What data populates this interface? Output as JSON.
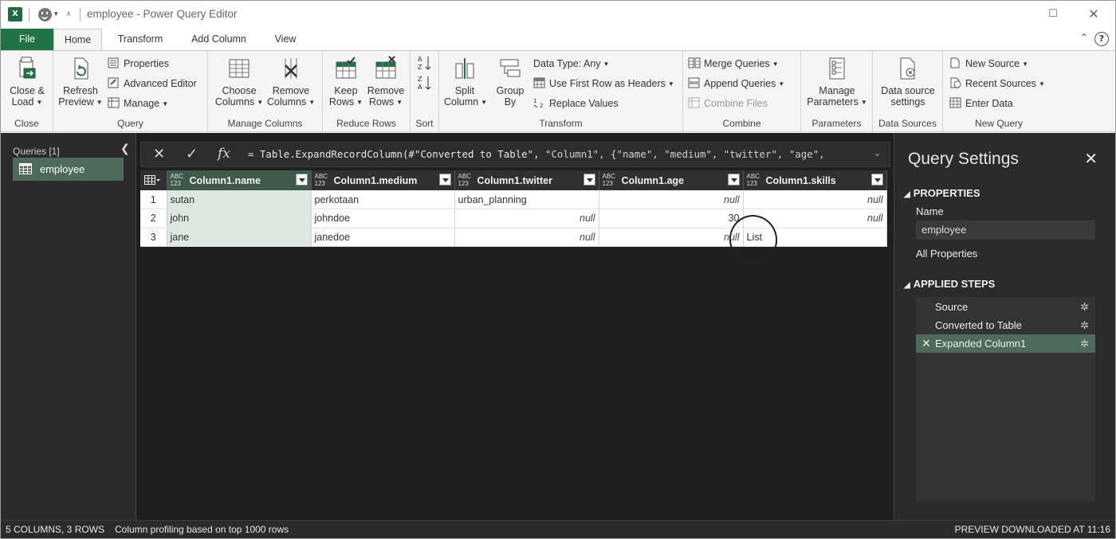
{
  "window": {
    "title": "employee - Power Query Editor",
    "app_icon": "excel-icon"
  },
  "tabs": [
    {
      "label": "File"
    },
    {
      "label": "Home"
    },
    {
      "label": "Transform"
    },
    {
      "label": "Add Column"
    },
    {
      "label": "View"
    }
  ],
  "ribbon": {
    "close": {
      "group_label": "Close",
      "close_load": "Close &",
      "close_load2": "Load"
    },
    "query": {
      "group_label": "Query",
      "refresh": "Refresh",
      "refresh2": "Preview",
      "properties": "Properties",
      "advanced_editor": "Advanced Editor",
      "manage": "Manage"
    },
    "manage_columns": {
      "group_label": "Manage Columns",
      "choose": "Choose",
      "choose2": "Columns",
      "remove": "Remove",
      "remove2": "Columns"
    },
    "reduce_rows": {
      "group_label": "Reduce Rows",
      "keep": "Keep",
      "keep2": "Rows",
      "remove": "Remove",
      "remove2": "Rows"
    },
    "sort": {
      "group_label": "Sort"
    },
    "transform": {
      "group_label": "Transform",
      "split": "Split",
      "split2": "Column",
      "group": "Group",
      "group2": "By",
      "data_type": "Data Type: Any",
      "first_row": "Use First Row as Headers",
      "replace": "Replace Values"
    },
    "combine": {
      "group_label": "Combine",
      "merge": "Merge Queries",
      "append": "Append Queries",
      "combine_files": "Combine Files"
    },
    "parameters": {
      "group_label": "Parameters",
      "manage": "Manage",
      "manage2": "Parameters"
    },
    "data_sources": {
      "group_label": "Data Sources",
      "settings": "Data source",
      "settings2": "settings"
    },
    "new_query": {
      "group_label": "New Query",
      "new_source": "New Source",
      "recent_sources": "Recent Sources",
      "enter_data": "Enter Data"
    }
  },
  "queries_pane": {
    "header": "Queries [1]",
    "items": [
      {
        "label": "employee"
      }
    ]
  },
  "formula_bar": {
    "prefix": "= Table.ExpandRecordColumn(#\"Converted to Table\", ",
    "rest": "\"Column1\", {\"name\", \"medium\", \"twitter\", \"age\","
  },
  "table": {
    "type_label_top": "ABC",
    "type_label_bottom": "123",
    "columns": [
      "Column1.name",
      "Column1.medium",
      "Column1.twitter",
      "Column1.age",
      "Column1.skills"
    ],
    "rows": [
      {
        "n": "1",
        "cells": [
          "sutan",
          "perkotaan",
          "urban_planning",
          "null",
          "null"
        ]
      },
      {
        "n": "2",
        "cells": [
          "john",
          "johndoe",
          "null",
          "30",
          "null"
        ]
      },
      {
        "n": "3",
        "cells": [
          "jane",
          "janedoe",
          "null",
          "null",
          "List"
        ]
      }
    ]
  },
  "query_settings": {
    "title": "Query Settings",
    "properties_header": "PROPERTIES",
    "name_label": "Name",
    "name_value": "employee",
    "all_properties": "All Properties",
    "applied_steps_header": "APPLIED STEPS",
    "steps": [
      {
        "label": "Source"
      },
      {
        "label": "Converted to Table"
      },
      {
        "label": "Expanded Column1"
      }
    ]
  },
  "status_bar": {
    "shape": "5 COLUMNS, 3 ROWS",
    "profiling": "Column profiling based on top 1000 rows",
    "preview": "PREVIEW DOWNLOADED AT 11:16"
  },
  "colors": {
    "accent_green": "#217346",
    "selected_step": "#4e6a5a",
    "selected_column": "#dbe7e0"
  }
}
